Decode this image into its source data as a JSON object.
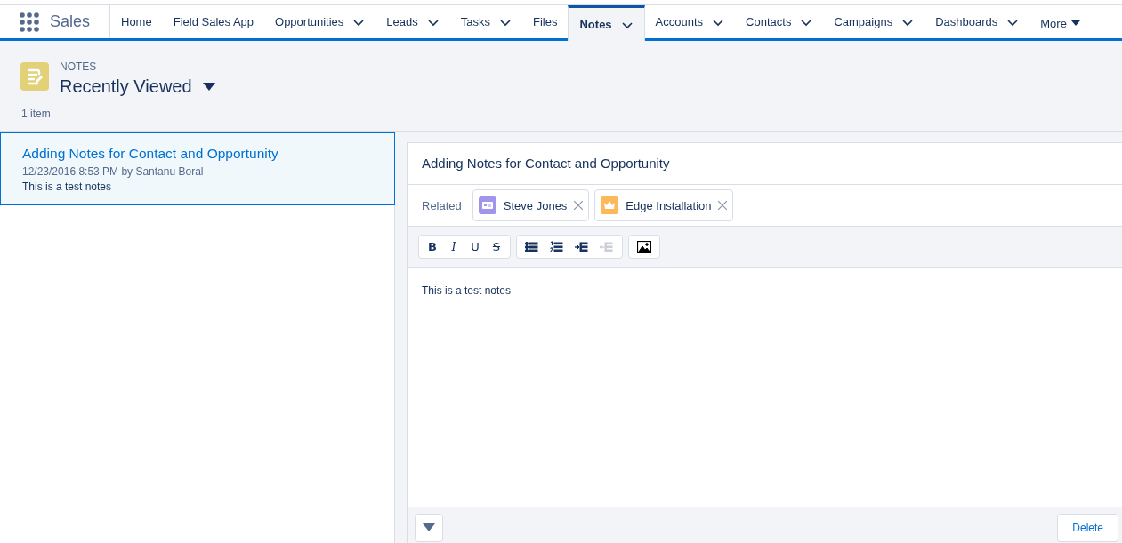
{
  "app": {
    "name": "Sales"
  },
  "tabs": [
    {
      "label": "Home",
      "selected": false,
      "menu": false
    },
    {
      "label": "Field Sales App",
      "selected": false,
      "menu": false
    },
    {
      "label": "Opportunities",
      "selected": false,
      "menu": true
    },
    {
      "label": "Leads",
      "selected": false,
      "menu": true
    },
    {
      "label": "Tasks",
      "selected": false,
      "menu": true
    },
    {
      "label": "Files",
      "selected": false,
      "menu": false
    },
    {
      "label": "Notes",
      "selected": true,
      "menu": true
    },
    {
      "label": "Accounts",
      "selected": false,
      "menu": true
    },
    {
      "label": "Contacts",
      "selected": false,
      "menu": true
    },
    {
      "label": "Campaigns",
      "selected": false,
      "menu": true
    },
    {
      "label": "Dashboards",
      "selected": false,
      "menu": true
    }
  ],
  "more": {
    "label": "More"
  },
  "header": {
    "object": "NOTES",
    "view": "Recently Viewed",
    "count": "1 item"
  },
  "notes_list": [
    {
      "title": "Adding Notes for Contact and Opportunity",
      "meta": "12/23/2016 8:53 PM by Santanu Boral",
      "preview": "This is a test notes",
      "selected": true
    }
  ],
  "editor": {
    "title": "Adding Notes for Contact and Opportunity",
    "related_label": "Related",
    "related": [
      {
        "kind": "contact",
        "label": "Steve Jones",
        "color": "#a094ed"
      },
      {
        "kind": "opportunity",
        "label": "Edge Installation",
        "color": "#fcb95b"
      }
    ],
    "toolbar": [
      [
        {
          "kind": "bold",
          "label": "B",
          "disabled": false
        },
        {
          "kind": "italic",
          "label": "I",
          "disabled": false
        },
        {
          "kind": "underline",
          "label": "U",
          "disabled": false
        },
        {
          "kind": "strike",
          "label": "S",
          "disabled": false
        }
      ],
      [
        {
          "kind": "bullets",
          "disabled": false
        },
        {
          "kind": "numbers",
          "disabled": false
        },
        {
          "kind": "indent",
          "disabled": false
        },
        {
          "kind": "outdent",
          "disabled": true
        }
      ],
      [
        {
          "kind": "image",
          "disabled": false
        }
      ]
    ],
    "body": "This is a test notes",
    "delete_label": "Delete"
  }
}
